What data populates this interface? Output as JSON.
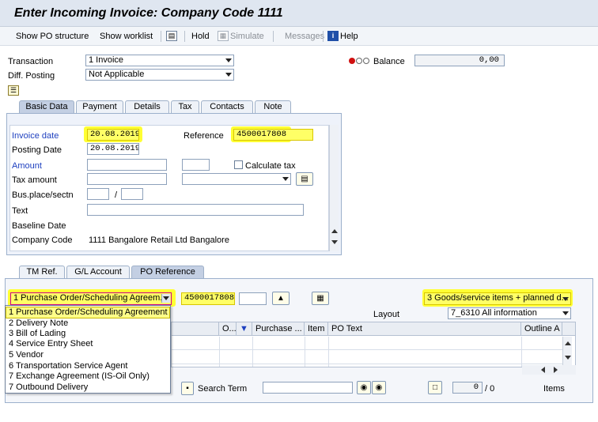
{
  "window": {
    "title": "Enter Incoming Invoice: Company Code 1111"
  },
  "toolbar": {
    "show_po_structure": "Show PO structure",
    "show_worklist": "Show worklist",
    "hold": "Hold",
    "simulate": "Simulate",
    "messages": "Messages",
    "help": "Help"
  },
  "header": {
    "transaction_label": "Transaction",
    "transaction_value": "1 Invoice",
    "diff_posting_label": "Diff. Posting",
    "diff_posting_value": "Not Applicable",
    "balance_label": "Balance",
    "balance_value": "0,00"
  },
  "tabs_top": [
    "Basic Data",
    "Payment",
    "Details",
    "Tax",
    "Contacts",
    "Note"
  ],
  "basic_data": {
    "invoice_date_label": "Invoice date",
    "invoice_date_value": "20.08.2019",
    "reference_label": "Reference",
    "reference_value": "4500017808",
    "posting_date_label": "Posting Date",
    "posting_date_value": "20.08.2019",
    "amount_label": "Amount",
    "calculate_tax_label": "Calculate tax",
    "tax_amount_label": "Tax amount",
    "bus_place_label": "Bus.place/sectn",
    "bus_place_sep": "/",
    "text_label": "Text",
    "baseline_date_label": "Baseline Date",
    "company_code_label": "Company Code",
    "company_code_value": "1111 Bangalore Retail Ltd Bangalore"
  },
  "tabs_bottom": [
    "TM Ref.",
    "G/L Account",
    "PO Reference"
  ],
  "po_reference": {
    "doc_type_value": "1 Purchase Order/Scheduling Agreem...",
    "po_number_value": "4500017808",
    "item_type_value": "3 Goods/service items + planned d...",
    "layout_label": "Layout",
    "layout_value": "7_6310 All information",
    "columns": [
      "O...",
      "Purchase ...",
      "Item",
      "PO Text",
      "Outline A"
    ],
    "search_term_label": "Search Term",
    "page_value": "0",
    "page_sep": "/ 0",
    "items_label": "Items"
  },
  "dropdown_menu": {
    "items": [
      "1 Purchase Order/Scheduling Agreement",
      "2 Delivery Note",
      "3 Bill of Lading",
      "4 Service Entry Sheet",
      "5 Vendor",
      "6 Transportation Service Agent",
      "7 Exchange Agreement (IS-Oil Only)",
      "7 Outbound Delivery"
    ]
  }
}
